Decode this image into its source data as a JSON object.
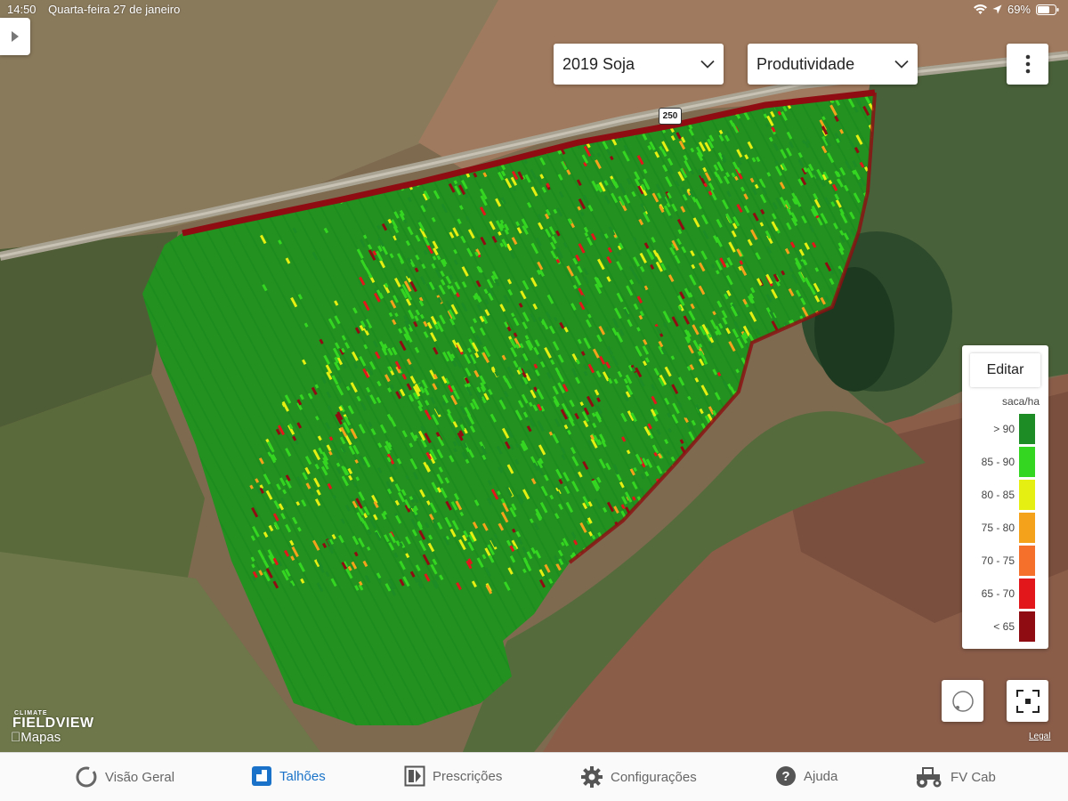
{
  "status_bar": {
    "time": "14:50",
    "date": "Quarta-feira 27 de janeiro",
    "battery": "69%"
  },
  "map": {
    "road_shield": "250",
    "brand_small": "CLIMATE",
    "brand": "FIELDVIEW",
    "maps_label": "Mapas",
    "legal": "Legal"
  },
  "controls": {
    "season": "2019 Soja",
    "layer": "Produtividade"
  },
  "legend": {
    "edit_label": "Editar",
    "unit": "saca/ha",
    "classes": [
      {
        "label": "> 90",
        "color": "#1e8c24"
      },
      {
        "label": "85 - 90",
        "color": "#35d622"
      },
      {
        "label": "80 - 85",
        "color": "#e6ef12"
      },
      {
        "label": "75 - 80",
        "color": "#f4a21c"
      },
      {
        "label": "70 - 75",
        "color": "#f5702a"
      },
      {
        "label": "65 - 70",
        "color": "#e1171c"
      },
      {
        "label": "< 65",
        "color": "#8f0c12"
      }
    ]
  },
  "tabs": [
    {
      "label": "Visão Geral",
      "icon": "overview-ring-icon",
      "active": false
    },
    {
      "label": "Talhões",
      "icon": "field-icon",
      "active": true
    },
    {
      "label": "Prescrições",
      "icon": "prescription-icon",
      "active": false
    },
    {
      "label": "Configurações",
      "icon": "gear-icon",
      "active": false
    },
    {
      "label": "Ajuda",
      "icon": "help-icon",
      "active": false
    },
    {
      "label": "FV Cab",
      "icon": "tractor-icon",
      "active": false
    }
  ],
  "colors": {
    "accent": "#1a73c8",
    "field_base": "#22911f"
  }
}
